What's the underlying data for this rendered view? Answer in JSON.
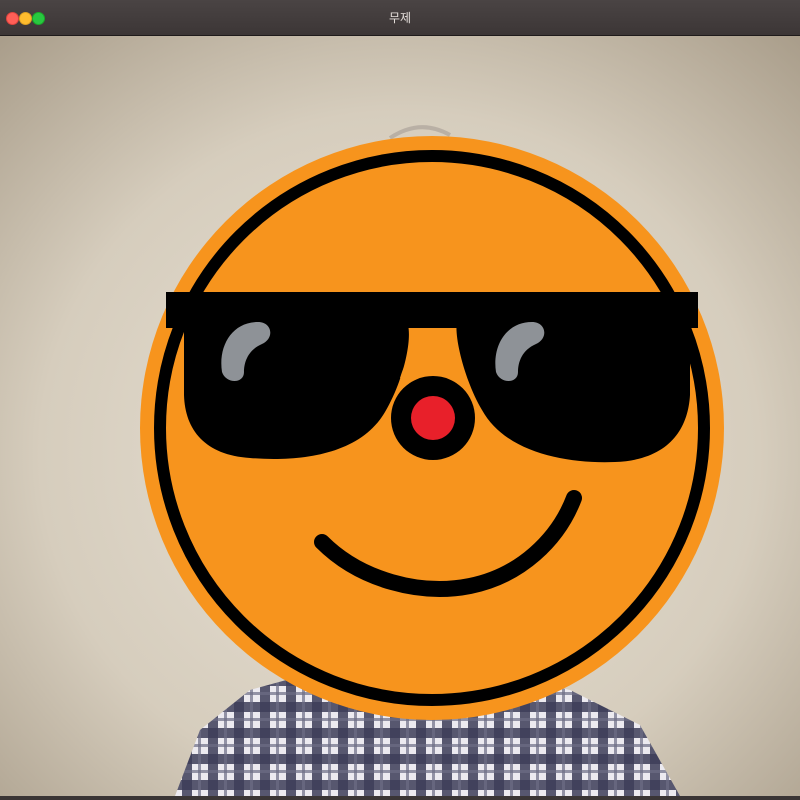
{
  "window": {
    "title": "무제",
    "controls": [
      "close-icon",
      "minimize-icon",
      "zoom-icon"
    ]
  },
  "scene": {
    "description_icons": [
      "smiley-face-sticker",
      "sunglasses-icon",
      "red-nose-icon"
    ],
    "colors": {
      "face": "#f7941d",
      "outline": "#000000",
      "nose": "#e8202a",
      "lens_glare": "#8e9297",
      "wall": "#d9d2c5",
      "shirt_dark": "#3a3a55",
      "shirt_light": "#e9e9f0"
    }
  }
}
